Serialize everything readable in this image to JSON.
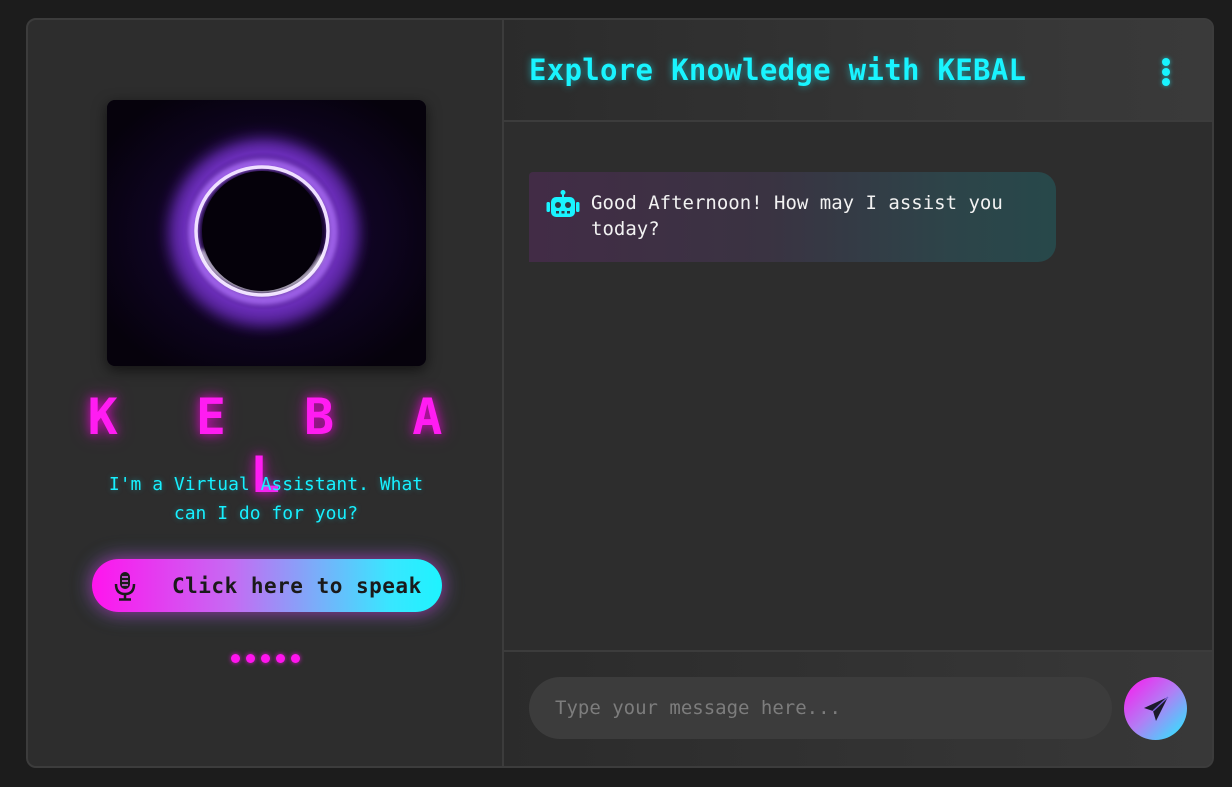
{
  "sidebar": {
    "brand": "K E B A L",
    "tagline": "I'm a Virtual Assistant. What can I do for you?",
    "speak_button_label": "Click here to speak",
    "mic_icon": "microphone-icon",
    "dots_count": 5
  },
  "header": {
    "title": "Explore Knowledge with KEBAL",
    "menu_icon": "kebab-menu-icon"
  },
  "messages": [
    {
      "sender": "bot",
      "icon": "robot-icon",
      "text": "Good Afternoon! How may I assist you today?"
    }
  ],
  "composer": {
    "placeholder": "Type your message here...",
    "value": "",
    "send_icon": "paper-plane-icon"
  },
  "colors": {
    "accent_cyan": "#19f4ff",
    "accent_magenta": "#ff14ee",
    "background": "#2d2d2d"
  }
}
